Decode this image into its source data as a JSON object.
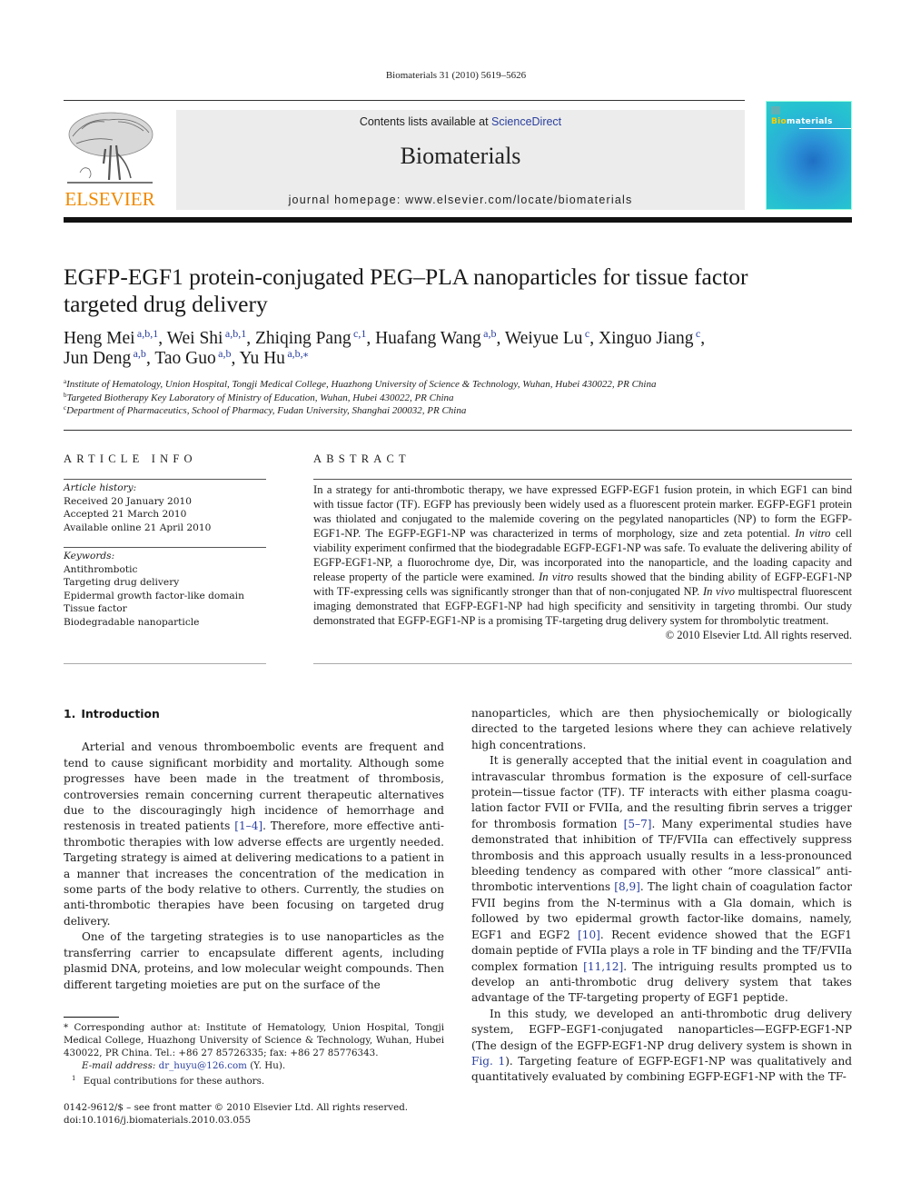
{
  "header": {
    "citation": "Biomaterials 31 (2010) 5619–5626",
    "contents_prefix": "Contents lists available at ",
    "contents_link": "ScienceDirect",
    "journal_name": "Biomaterials",
    "homepage": "journal homepage: www.elsevier.com/locate/biomaterials",
    "publisher_logo": "ELSEVIER",
    "cover": {
      "title_highlight": "Bio",
      "title_rest": "materials"
    }
  },
  "article": {
    "title": "EGFP-EGF1 protein-conjugated PEG–PLA nanoparticles for tissue factor targeted drug delivery",
    "authors": [
      {
        "name": "Heng Mei",
        "sup": "a,b,1",
        "sep": ", "
      },
      {
        "name": "Wei Shi",
        "sup": "a,b,1",
        "sep": ", "
      },
      {
        "name": "Zhiqing Pang",
        "sup": "c,1",
        "sep": ", "
      },
      {
        "name": "Huafang Wang",
        "sup": "a,b",
        "sep": ", "
      },
      {
        "name": "Weiyue Lu",
        "sup": "c",
        "sep": ", "
      },
      {
        "name": "Xinguo Jiang",
        "sup": "c",
        "sep": ","
      },
      {
        "name": "Jun Deng",
        "sup": "a,b",
        "sep": ", "
      },
      {
        "name": "Tao Guo",
        "sup": "a,b",
        "sep": ", "
      },
      {
        "name": "Yu Hu",
        "sup": "a,b,⁎",
        "sep": ""
      }
    ],
    "affiliations": [
      {
        "key": "a",
        "text": "Institute of Hematology, Union Hospital, Tongji Medical College, Huazhong University of Science & Technology, Wuhan, Hubei 430022, PR China"
      },
      {
        "key": "b",
        "text": "Targeted Biotherapy Key Laboratory of Ministry of Education, Wuhan, Hubei 430022, PR China"
      },
      {
        "key": "c",
        "text": "Department of Pharmaceutics, School of Pharmacy, Fudan University, Shanghai 200032, PR China"
      }
    ]
  },
  "article_info": {
    "label": "ARTICLE INFO",
    "history_label": "Article history:",
    "history": [
      "Received 20 January 2010",
      "Accepted 21 March 2010",
      "Available online 21 April 2010"
    ],
    "keywords_label": "Keywords:",
    "keywords": [
      "Antithrombotic",
      "Targeting drug delivery",
      "Epidermal growth factor-like domain",
      "Tissue factor",
      "Biodegradable nanoparticle"
    ]
  },
  "abstract": {
    "label": "ABSTRACT",
    "segments": [
      {
        "t": "In a strategy for anti-thrombotic therapy, we have expressed EGFP-EGF1 fusion protein, in which EGF1 can bind with tissue factor (TF). EGFP has previously been widely used as a fluorescent protein marker. EGFP-EGF1 protein was thiolated and conjugated to the malemide covering on the pegylated nano­particles (NP) to form the EGFP-EGF1-NP. The EGFP-EGF1-NP was characterized in terms of morphology, size and zeta potential. "
      },
      {
        "t": "In vitro",
        "i": true
      },
      {
        "t": " cell viability experiment confirmed that the biodegradable EGFP-EGF1-NP was safe. To evaluate the delivering ability of EGFP-EGF1-NP, a fluorochrome dye, Dir, was incorporated into the nanoparticle, and the loading capacity and release property of the particle were examined. "
      },
      {
        "t": "In vitro",
        "i": true
      },
      {
        "t": " results showed that the binding ability of EGFP-EGF1-NP with TF-expressing cells was significantly stronger than that of non-conjugated NP. "
      },
      {
        "t": "In vivo",
        "i": true
      },
      {
        "t": " multispectral fluorescent imaging demonstrated that EGFP-EGF1-NP had high specificity and sensitivity in targeting thrombi. Our study demonstrated that EGFP-EGF1-NP is a promising TF-targeting drug delivery system for thrombolytic treatment."
      }
    ],
    "rights": "© 2010 Elsevier Ltd. All rights reserved."
  },
  "body": {
    "section_number": "1.",
    "section_title": "Introduction",
    "left_paragraphs": [
      [
        {
          "t": "Arterial and venous thromboembolic events are frequent and tend to cause significant morbidity and mortality. Although some progresses have been made in the treatment of thrombosis, controversies remain concerning current therapeutic alternatives due to the discouragingly high incidence of hemorrhage and restenosis in treated patients "
        },
        {
          "t": "[1–4]",
          "link": true
        },
        {
          "t": ". Therefore, more effective anti-thrombotic therapies with low adverse effects are urgently needed. Targeting strategy is aimed at delivering medications to a patient in a manner that increases the concentration of the medication in some parts of the body relative to others. Currently, the studies on anti-thrombotic therapies have been focusing on targeted drug delivery."
        }
      ],
      [
        {
          "t": "One of the targeting strategies is to use nanoparticles as the transferring carrier to encapsulate different agents, including plasmid DNA, proteins, and low molecular weight compounds. Then different targeting moieties are put on the surface of the"
        }
      ]
    ],
    "right_paragraphs": [
      {
        "indent": false,
        "segs": [
          {
            "t": "nanoparticles, which are then physiochemically or biologically directed to the targeted lesions where they can achieve relatively high concentrations."
          }
        ]
      },
      {
        "indent": true,
        "segs": [
          {
            "t": "It is generally accepted that the initial event in coagulation and intravascular thrombus formation is the exposure of cell-surface protein—tissue factor (TF). TF interacts with either plasma coagu­lation factor FVII or FVIIa, and the resulting fibrin serves a trigger for thrombosis formation "
          },
          {
            "t": "[5–7]",
            "link": true
          },
          {
            "t": ". Many experimental studies have demonstrated that inhibition of TF/FVIIa can effectively suppress thrombosis and this approach usually results in a less-pronounced bleeding tendency as compared with other “more classical” anti-thrombotic interventions "
          },
          {
            "t": "[8,9]",
            "link": true
          },
          {
            "t": ". The light chain of coagulation factor FVII begins from the N-terminus with a Gla domain, which is followed by two epidermal growth factor-like domains, namely, EGF1 and EGF2 "
          },
          {
            "t": "[10]",
            "link": true
          },
          {
            "t": ". Recent evidence showed that the EGF1 domain peptide of FVIIa plays a role in TF binding and the TF/FVIIa complex formation "
          },
          {
            "t": "[11,12]",
            "link": true
          },
          {
            "t": ". The intriguing results prompted us to develop an anti-thrombotic drug delivery system that takes advantage of the TF-targeting property of EGF1 peptide."
          }
        ]
      },
      {
        "indent": true,
        "segs": [
          {
            "t": "In this study, we developed an anti-thrombotic drug delivery system, EGFP–EGF1-conjugated nanoparticles—EGFP-EGF1-NP (The design of the EGFP-EGF1-NP drug delivery system is shown in "
          },
          {
            "t": "Fig. 1",
            "link": true
          },
          {
            "t": "). Targeting feature of EGFP-EGF1-NP was qualitatively and quantitatively evaluated by combining EGFP-EGF1-NP with the TF-"
          }
        ]
      }
    ]
  },
  "footnotes": {
    "corresponding_mark": "*",
    "corresponding": "Corresponding author at: Institute of Hematology, Union Hospital, Tongji Medical College, Huazhong University of Science & Technology, Wuhan, Hubei 430022, PR China. Tel.: +86 27 85726335; fax: +86 27 85776343.",
    "email_label": "E-mail address:",
    "email": "dr_huyu@126.com",
    "email_suffix": " (Y. Hu).",
    "equal_mark": "1",
    "equal": "Equal contributions for these authors.",
    "issn": "0142-9612/$ – see front matter © 2010 Elsevier Ltd. All rights reserved.",
    "doi": "doi:10.1016/j.biomaterials.2010.03.055"
  }
}
